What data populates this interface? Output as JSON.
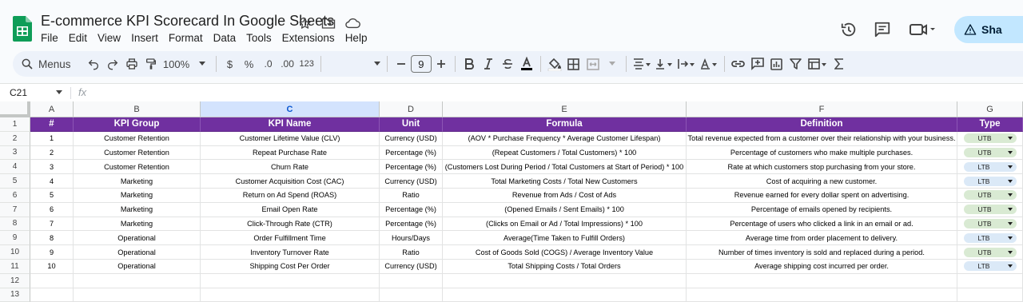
{
  "app": {
    "title": "E-commerce KPI Scorecard In Google Sheets",
    "menus": [
      "File",
      "Edit",
      "View",
      "Insert",
      "Format",
      "Data",
      "Tools",
      "Extensions",
      "Help"
    ],
    "share_label": "Sha"
  },
  "toolbar": {
    "menus_label": "Menus",
    "zoom": "100%",
    "currency": "$",
    "percent": "%",
    "decrease_decimal": ".0",
    "increase_decimal": ".00",
    "number_format": "123",
    "font_size": "9"
  },
  "formula_bar": {
    "name_box": "C21",
    "fx_label": "fx",
    "value": ""
  },
  "sheet": {
    "column_letters": [
      "A",
      "B",
      "C",
      "D",
      "E",
      "F",
      "G"
    ],
    "selected_column": "C",
    "header": [
      "#",
      "KPI Group",
      "KPI Name",
      "Unit",
      "Formula",
      "Definition",
      "Type"
    ],
    "row_numbers": [
      "1",
      "2",
      "3",
      "4",
      "5",
      "6",
      "7",
      "8",
      "9",
      "10",
      "11",
      "12",
      "13"
    ],
    "rows": [
      {
        "num": "1",
        "group": "Customer Retention",
        "name": "Customer Lifetime Value (CLV)",
        "unit": "Currency (USD)",
        "formula": "(AOV * Purchase Frequency * Average Customer Lifespan)",
        "definition": "Total revenue expected from a customer over their relationship with your business.",
        "type": "UTB"
      },
      {
        "num": "2",
        "group": "Customer Retention",
        "name": "Repeat Purchase Rate",
        "unit": "Percentage (%)",
        "formula": "(Repeat Customers / Total Customers) * 100",
        "definition": "Percentage of customers who make multiple purchases.",
        "type": "UTB"
      },
      {
        "num": "3",
        "group": "Customer Retention",
        "name": "Churn Rate",
        "unit": "Percentage (%)",
        "formula": "(Customers Lost During Period / Total Customers at Start of Period) * 100",
        "definition": "Rate at which customers stop purchasing from your store.",
        "type": "LTB"
      },
      {
        "num": "4",
        "group": "Marketing",
        "name": "Customer Acquisition Cost (CAC)",
        "unit": "Currency (USD)",
        "formula": "Total Marketing Costs / Total New Customers",
        "definition": "Cost of acquiring a new customer.",
        "type": "LTB"
      },
      {
        "num": "5",
        "group": "Marketing",
        "name": "Return on Ad Spend (ROAS)",
        "unit": "Ratio",
        "formula": "Revenue from Ads / Cost of Ads",
        "definition": "Revenue earned for every dollar spent on advertising.",
        "type": "UTB"
      },
      {
        "num": "6",
        "group": "Marketing",
        "name": "Email Open Rate",
        "unit": "Percentage (%)",
        "formula": "(Opened Emails / Sent Emails) * 100",
        "definition": "Percentage of emails opened by recipients.",
        "type": "UTB"
      },
      {
        "num": "7",
        "group": "Marketing",
        "name": "Click-Through Rate (CTR)",
        "unit": "Percentage (%)",
        "formula": "(Clicks on Email or Ad / Total Impressions) * 100",
        "definition": "Percentage of users who clicked a link in an email or ad.",
        "type": "UTB"
      },
      {
        "num": "8",
        "group": "Operational",
        "name": "Order Fulfillment Time",
        "unit": "Hours/Days",
        "formula": "Average(Time Taken to Fulfill Orders)",
        "definition": "Average time from order placement to delivery.",
        "type": "LTB"
      },
      {
        "num": "9",
        "group": "Operational",
        "name": "Inventory Turnover Rate",
        "unit": "Ratio",
        "formula": "Cost of Goods Sold (COGS) / Average Inventory Value",
        "definition": "Number of times inventory is sold and replaced during a period.",
        "type": "UTB"
      },
      {
        "num": "10",
        "group": "Operational",
        "name": "Shipping Cost Per Order",
        "unit": "Currency (USD)",
        "formula": "Total Shipping Costs / Total Orders",
        "definition": "Average shipping cost incurred per order.",
        "type": "LTB"
      }
    ]
  },
  "colors": {
    "header_bg": "#7030a0",
    "utb_chip": "#d9ead3",
    "ltb_chip": "#dbe9f7",
    "selected_col": "#d3e3fd",
    "share_bg": "#c2e7ff"
  }
}
